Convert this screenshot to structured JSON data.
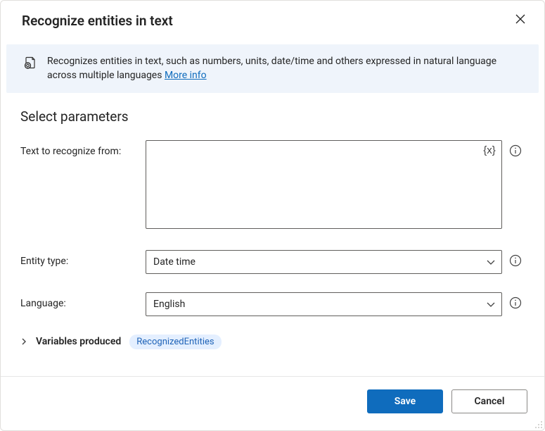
{
  "header": {
    "title": "Recognize entities in text"
  },
  "banner": {
    "text": "Recognizes entities in text, such as numbers, units, date/time and others expressed in natural language across multiple languages ",
    "more_info": "More info"
  },
  "section_heading": "Select parameters",
  "fields": {
    "text_to_recognize": {
      "label": "Text to recognize from:",
      "value": "",
      "placeholder": ""
    },
    "entity_type": {
      "label": "Entity type:",
      "value": "Date time"
    },
    "language": {
      "label": "Language:",
      "value": "English"
    }
  },
  "variables": {
    "label": "Variables produced",
    "output_name": "RecognizedEntities"
  },
  "footer": {
    "save": "Save",
    "cancel": "Cancel"
  },
  "icons": {
    "variable_token": "{x}"
  }
}
